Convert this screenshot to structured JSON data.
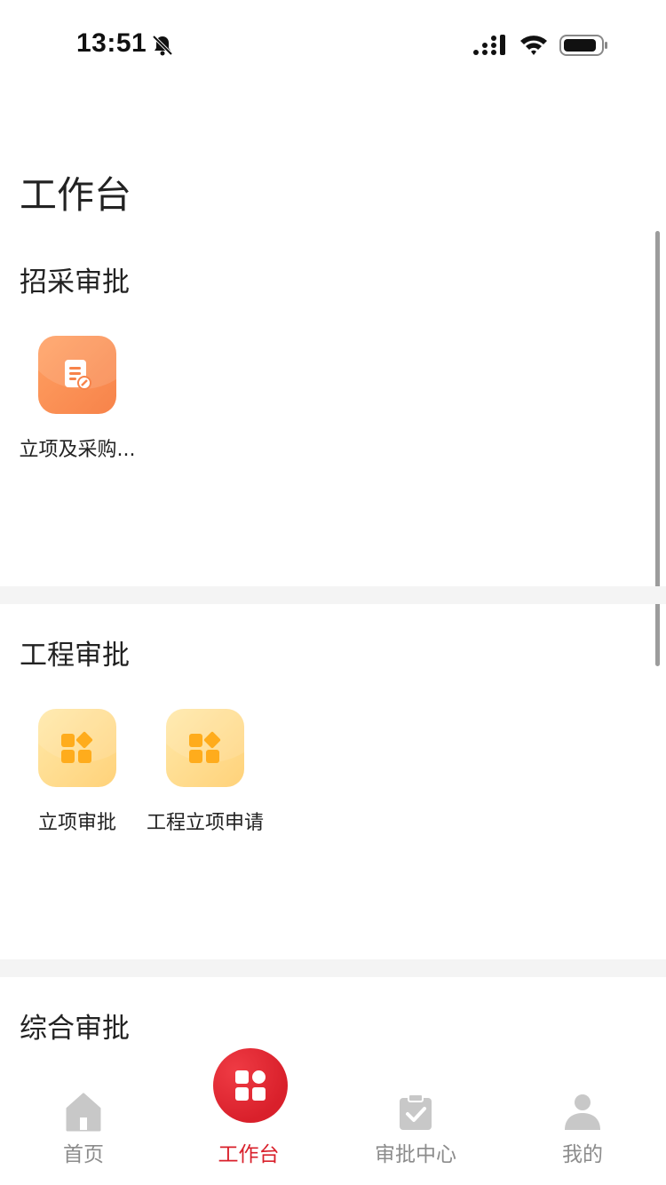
{
  "status_bar": {
    "time": "13:51",
    "icons": [
      "bell-off-icon",
      "signal-icon",
      "wifi-icon",
      "battery-icon"
    ]
  },
  "page": {
    "title": "工作台"
  },
  "sections": [
    {
      "title": "招采审批",
      "apps": [
        {
          "label": "立项及采购...",
          "icon": "document-edit-icon",
          "color": "#f7834a"
        }
      ]
    },
    {
      "title": "工程审批",
      "apps": [
        {
          "label": "立项审批",
          "icon": "apps-grid-icon",
          "color": "#ffd27a"
        },
        {
          "label": "工程立项申请",
          "icon": "apps-grid-icon",
          "color": "#ffd27a"
        }
      ]
    },
    {
      "title": "综合审批",
      "apps": []
    }
  ],
  "tab_bar": {
    "items": [
      {
        "label": "首页",
        "icon": "home-icon",
        "active": false
      },
      {
        "label": "工作台",
        "icon": "grid-icon",
        "active": true
      },
      {
        "label": "审批中心",
        "icon": "clipboard-check-icon",
        "active": false
      },
      {
        "label": "我的",
        "icon": "user-icon",
        "active": false
      }
    ]
  },
  "colors": {
    "accent": "#d9202b",
    "inactive_tab": "#8c8c8c",
    "section_divider": "#f4f4f4"
  }
}
